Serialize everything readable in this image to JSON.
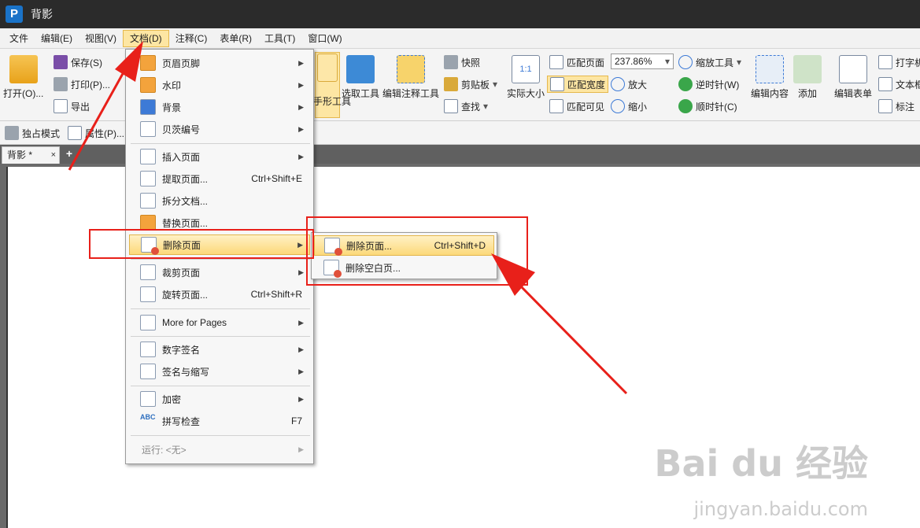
{
  "window": {
    "title": "背影",
    "logo_letter": "P"
  },
  "menubar": [
    {
      "label": "文件"
    },
    {
      "label": "编辑(E)"
    },
    {
      "label": "视图(V)"
    },
    {
      "label": "文档(D)"
    },
    {
      "label": "注释(C)"
    },
    {
      "label": "表单(R)"
    },
    {
      "label": "工具(T)"
    },
    {
      "label": "窗口(W)"
    }
  ],
  "ribbon": {
    "open": "打开(O)...",
    "save": "保存(S)",
    "print": "打印(P)...",
    "export": "导出",
    "exclusive": "独占模式",
    "properties": "属性(P)...",
    "hand_tool": "手形工具",
    "select_tool": "选取工具",
    "edit_annot_tool": "编辑注释工具",
    "snapshot": "快照",
    "clipboard": "剪贴板",
    "find": "查找",
    "actual_size": "实际大小",
    "actual_size_icon": "1:1",
    "fit_page": "匹配页面",
    "fit_width": "匹配宽度",
    "fit_visible": "匹配可见",
    "zoom_value": "237.86%",
    "zoom_tool": "缩放工具",
    "zoom_in": "放大",
    "zoom_out": "缩小",
    "rotate_ccw": "逆时针(W)",
    "rotate_cw": "顺时针(C)",
    "edit_content": "编辑内容",
    "add": "添加",
    "edit_form": "编辑表单",
    "typewriter": "打字机",
    "textbox": "文本框",
    "callout": "标注"
  },
  "tabs": {
    "doc_tab": "背影 *",
    "close": "×",
    "add": "+"
  },
  "dropdown": {
    "items": [
      {
        "label": "页眉页脚",
        "shortcut": "",
        "submenu": true
      },
      {
        "label": "水印",
        "shortcut": "",
        "submenu": true
      },
      {
        "label": "背景",
        "shortcut": "",
        "submenu": true
      },
      {
        "label": "贝茨编号",
        "shortcut": "",
        "submenu": true
      },
      {
        "label": "插入页面",
        "shortcut": "",
        "submenu": true
      },
      {
        "label": "提取页面...",
        "shortcut": "Ctrl+Shift+E",
        "submenu": false
      },
      {
        "label": "拆分文档...",
        "shortcut": "",
        "submenu": false
      },
      {
        "label": "替换页面...",
        "shortcut": "",
        "submenu": false
      },
      {
        "label": "删除页面",
        "shortcut": "",
        "submenu": true
      },
      {
        "label": "裁剪页面",
        "shortcut": "",
        "submenu": true
      },
      {
        "label": "旋转页面...",
        "shortcut": "Ctrl+Shift+R",
        "submenu": false
      },
      {
        "label": "More for Pages",
        "shortcut": "",
        "submenu": true
      },
      {
        "label": "数字签名",
        "shortcut": "",
        "submenu": true
      },
      {
        "label": "签名与缩写",
        "shortcut": "",
        "submenu": true
      },
      {
        "label": "加密",
        "shortcut": "",
        "submenu": true
      },
      {
        "label": "拼写检查",
        "shortcut": "F7",
        "submenu": false
      },
      {
        "label": "运行: <无>",
        "shortcut": "",
        "submenu": true
      }
    ],
    "abc_icon": "ABC"
  },
  "submenu": {
    "items": [
      {
        "label": "删除页面...",
        "shortcut": "Ctrl+Shift+D"
      },
      {
        "label": "删除空白页..."
      }
    ]
  },
  "watermark": {
    "brand": "Bai du 经验",
    "url": "jingyan.baidu.com"
  },
  "colors": {
    "annotation_red": "#e8201a",
    "highlight": "#fcd97a"
  }
}
